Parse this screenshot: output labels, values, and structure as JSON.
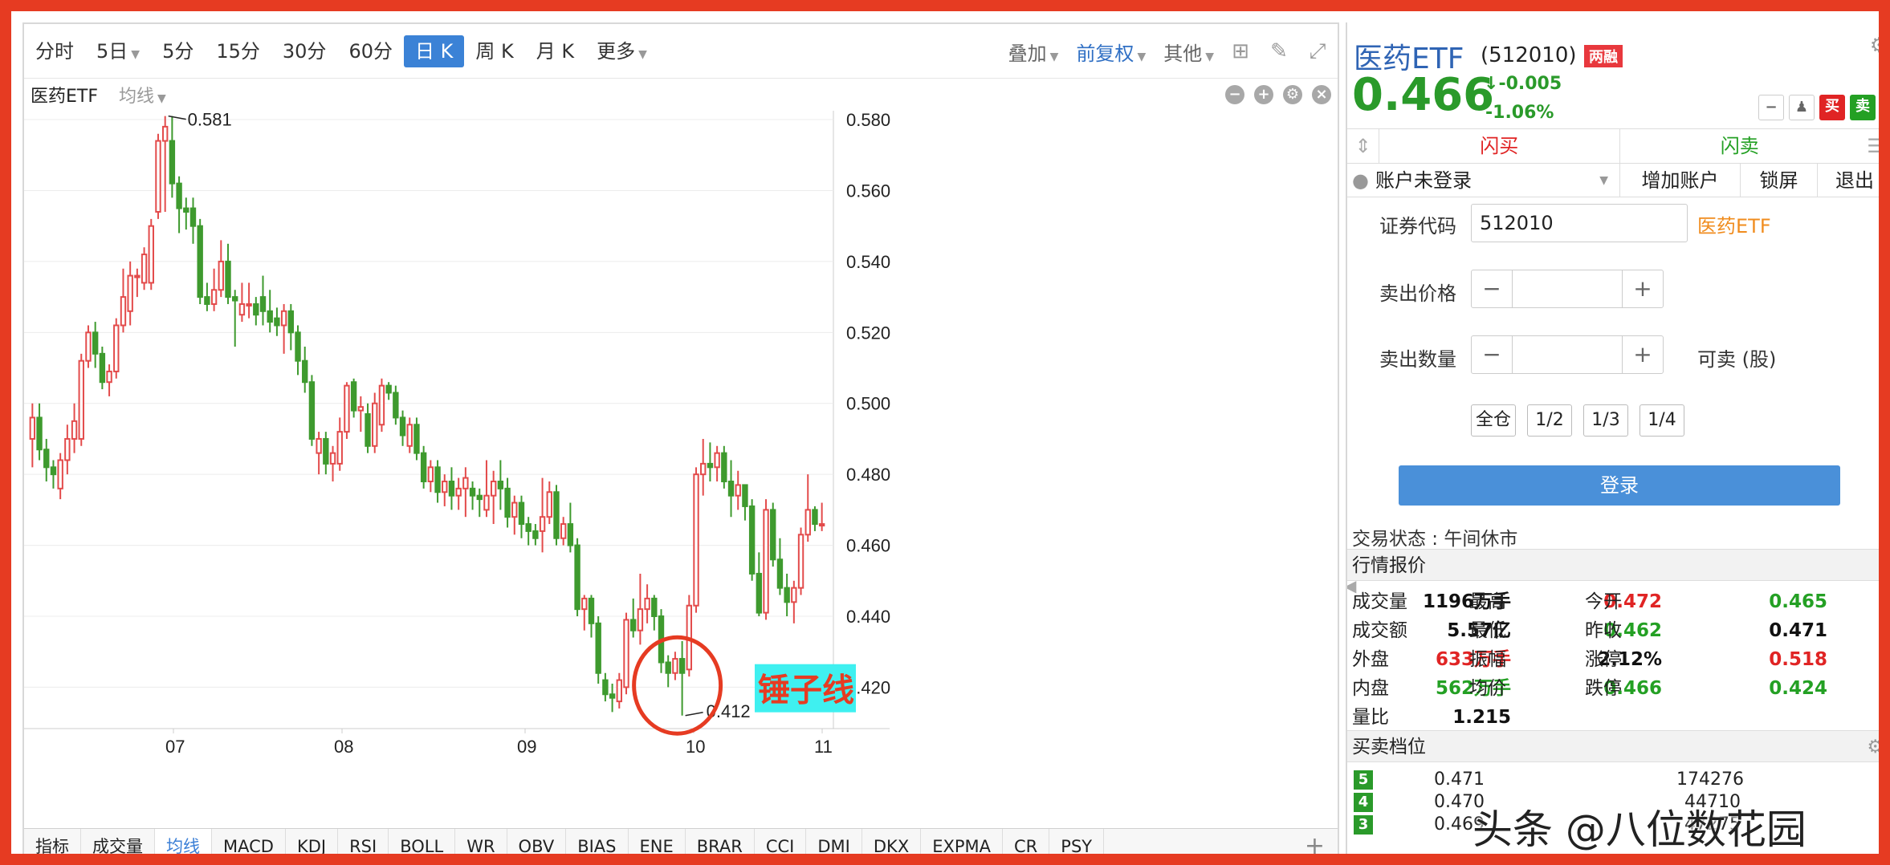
{
  "toolbar": {
    "periods": [
      "分时",
      "5日",
      "5分",
      "15分",
      "30分",
      "60分",
      "日 K",
      "周 K",
      "月 K",
      "更多"
    ],
    "active_period": "日 K",
    "overlay": "叠加",
    "adjust": "前复权",
    "other": "其他"
  },
  "subbar": {
    "name": "医药ETF",
    "ma": "均线"
  },
  "chart_data": {
    "type": "candlestick",
    "y_ticks": [
      "0.580",
      "0.560",
      "0.540",
      "0.520",
      "0.500",
      "0.480",
      "0.460",
      "0.440",
      "0.420"
    ],
    "ylim": [
      0.4115,
      0.5825
    ],
    "x_ticks": [
      "07",
      "08",
      "09",
      "10",
      "11"
    ],
    "high_label": "0.581",
    "low_label": "0.412",
    "annotation": "锤子线",
    "up_color": "#e34b4b",
    "down_color": "#3e9a2e",
    "candles": [
      [
        0.49,
        0.496,
        0.482,
        0.5
      ],
      [
        0.496,
        0.487,
        0.484,
        0.5
      ],
      [
        0.487,
        0.482,
        0.478,
        0.49
      ],
      [
        0.482,
        0.48,
        0.476,
        0.484
      ],
      [
        0.476,
        0.484,
        0.473,
        0.486
      ],
      [
        0.484,
        0.49,
        0.48,
        0.494
      ],
      [
        0.49,
        0.495,
        0.486,
        0.5
      ],
      [
        0.49,
        0.512,
        0.488,
        0.514
      ],
      [
        0.512,
        0.52,
        0.51,
        0.522
      ],
      [
        0.52,
        0.514,
        0.51,
        0.523
      ],
      [
        0.514,
        0.506,
        0.504,
        0.516
      ],
      [
        0.506,
        0.509,
        0.502,
        0.511
      ],
      [
        0.509,
        0.522,
        0.507,
        0.524
      ],
      [
        0.522,
        0.53,
        0.52,
        0.538
      ],
      [
        0.526,
        0.536,
        0.522,
        0.54
      ],
      [
        0.536,
        0.536,
        0.53,
        0.538
      ],
      [
        0.534,
        0.542,
        0.532,
        0.544
      ],
      [
        0.534,
        0.55,
        0.532,
        0.552
      ],
      [
        0.554,
        0.574,
        0.552,
        0.576
      ],
      [
        0.574,
        0.578,
        0.554,
        0.581
      ],
      [
        0.574,
        0.562,
        0.558,
        0.581
      ],
      [
        0.562,
        0.555,
        0.548,
        0.564
      ],
      [
        0.555,
        0.554,
        0.549,
        0.558
      ],
      [
        0.555,
        0.55,
        0.545,
        0.558
      ],
      [
        0.55,
        0.53,
        0.528,
        0.552
      ],
      [
        0.53,
        0.528,
        0.526,
        0.534
      ],
      [
        0.528,
        0.532,
        0.526,
        0.538
      ],
      [
        0.532,
        0.54,
        0.53,
        0.546
      ],
      [
        0.54,
        0.53,
        0.528,
        0.545
      ],
      [
        0.53,
        0.529,
        0.516,
        0.532
      ],
      [
        0.525,
        0.528,
        0.523,
        0.534
      ],
      [
        0.528,
        0.528,
        0.524,
        0.534
      ],
      [
        0.528,
        0.525,
        0.522,
        0.53
      ],
      [
        0.53,
        0.526,
        0.522,
        0.536
      ],
      [
        0.526,
        0.523,
        0.52,
        0.532
      ],
      [
        0.524,
        0.522,
        0.519,
        0.527
      ],
      [
        0.522,
        0.526,
        0.514,
        0.528
      ],
      [
        0.526,
        0.52,
        0.515,
        0.528
      ],
      [
        0.52,
        0.512,
        0.508,
        0.522
      ],
      [
        0.512,
        0.506,
        0.503,
        0.516
      ],
      [
        0.506,
        0.49,
        0.488,
        0.508
      ],
      [
        0.486,
        0.49,
        0.48,
        0.492
      ],
      [
        0.49,
        0.483,
        0.48,
        0.492
      ],
      [
        0.483,
        0.486,
        0.478,
        0.488
      ],
      [
        0.483,
        0.492,
        0.481,
        0.496
      ],
      [
        0.492,
        0.505,
        0.49,
        0.506
      ],
      [
        0.506,
        0.498,
        0.496,
        0.507
      ],
      [
        0.498,
        0.499,
        0.492,
        0.502
      ],
      [
        0.497,
        0.488,
        0.486,
        0.5
      ],
      [
        0.488,
        0.5,
        0.486,
        0.503
      ],
      [
        0.494,
        0.505,
        0.492,
        0.507
      ],
      [
        0.505,
        0.503,
        0.501,
        0.506
      ],
      [
        0.503,
        0.496,
        0.494,
        0.505
      ],
      [
        0.496,
        0.491,
        0.488,
        0.498
      ],
      [
        0.488,
        0.494,
        0.486,
        0.496
      ],
      [
        0.494,
        0.486,
        0.484,
        0.496
      ],
      [
        0.486,
        0.478,
        0.476,
        0.488
      ],
      [
        0.478,
        0.482,
        0.475,
        0.484
      ],
      [
        0.482,
        0.475,
        0.472,
        0.484
      ],
      [
        0.475,
        0.478,
        0.471,
        0.48
      ],
      [
        0.478,
        0.474,
        0.47,
        0.482
      ],
      [
        0.474,
        0.476,
        0.47,
        0.479
      ],
      [
        0.476,
        0.479,
        0.468,
        0.482
      ],
      [
        0.476,
        0.474,
        0.47,
        0.478
      ],
      [
        0.474,
        0.473,
        0.468,
        0.476
      ],
      [
        0.47,
        0.474,
        0.468,
        0.484
      ],
      [
        0.474,
        0.478,
        0.466,
        0.481
      ],
      [
        0.478,
        0.476,
        0.47,
        0.484
      ],
      [
        0.476,
        0.468,
        0.465,
        0.479
      ],
      [
        0.468,
        0.472,
        0.463,
        0.474
      ],
      [
        0.472,
        0.466,
        0.462,
        0.474
      ],
      [
        0.466,
        0.464,
        0.46,
        0.468
      ],
      [
        0.464,
        0.462,
        0.46,
        0.466
      ],
      [
        0.464,
        0.468,
        0.458,
        0.479
      ],
      [
        0.468,
        0.475,
        0.466,
        0.478
      ],
      [
        0.475,
        0.462,
        0.46,
        0.477
      ],
      [
        0.462,
        0.466,
        0.46,
        0.468
      ],
      [
        0.466,
        0.46,
        0.458,
        0.472
      ],
      [
        0.46,
        0.442,
        0.44,
        0.462
      ],
      [
        0.442,
        0.445,
        0.436,
        0.446
      ],
      [
        0.445,
        0.438,
        0.434,
        0.446
      ],
      [
        0.438,
        0.424,
        0.421,
        0.44
      ],
      [
        0.422,
        0.418,
        0.416,
        0.424
      ],
      [
        0.418,
        0.417,
        0.413,
        0.421
      ],
      [
        0.416,
        0.422,
        0.414,
        0.424
      ],
      [
        0.42,
        0.439,
        0.418,
        0.441
      ],
      [
        0.439,
        0.436,
        0.434,
        0.445
      ],
      [
        0.436,
        0.442,
        0.432,
        0.452
      ],
      [
        0.442,
        0.445,
        0.438,
        0.449
      ],
      [
        0.445,
        0.44,
        0.436,
        0.446
      ],
      [
        0.44,
        0.427,
        0.424,
        0.442
      ],
      [
        0.427,
        0.424,
        0.42,
        0.429
      ],
      [
        0.424,
        0.428,
        0.422,
        0.43
      ],
      [
        0.428,
        0.424,
        0.412,
        0.433
      ],
      [
        0.425,
        0.443,
        0.423,
        0.446
      ],
      [
        0.443,
        0.48,
        0.441,
        0.482
      ],
      [
        0.48,
        0.483,
        0.474,
        0.49
      ],
      [
        0.483,
        0.482,
        0.478,
        0.489
      ],
      [
        0.482,
        0.486,
        0.478,
        0.488
      ],
      [
        0.486,
        0.478,
        0.476,
        0.488
      ],
      [
        0.478,
        0.474,
        0.468,
        0.484
      ],
      [
        0.474,
        0.477,
        0.47,
        0.481
      ],
      [
        0.477,
        0.471,
        0.467,
        0.474
      ],
      [
        0.471,
        0.452,
        0.45,
        0.473
      ],
      [
        0.452,
        0.441,
        0.44,
        0.458
      ],
      [
        0.441,
        0.47,
        0.439,
        0.473
      ],
      [
        0.47,
        0.456,
        0.454,
        0.472
      ],
      [
        0.456,
        0.448,
        0.446,
        0.462
      ],
      [
        0.448,
        0.444,
        0.44,
        0.452
      ],
      [
        0.444,
        0.448,
        0.438,
        0.45
      ],
      [
        0.448,
        0.463,
        0.446,
        0.465
      ],
      [
        0.463,
        0.47,
        0.461,
        0.48
      ],
      [
        0.47,
        0.466,
        0.464,
        0.471
      ],
      [
        0.466,
        0.466,
        0.464,
        0.472
      ]
    ]
  },
  "bottom_tabs": [
    "指标",
    "成交量",
    "均线",
    "MACD",
    "KDJ",
    "RSI",
    "BOLL",
    "WR",
    "OBV",
    "BIAS",
    "ENE",
    "BRAR",
    "CCI",
    "DMI",
    "DKX",
    "EXPMA",
    "CR",
    "PSY"
  ],
  "bottom_active": "均线",
  "quote": {
    "name": "医药ETF",
    "code": "(512010)",
    "badge": "两融",
    "price": "0.466",
    "change": "-0.005",
    "change_pct": "-1.06%",
    "btn_buy": "买",
    "btn_sell": "卖"
  },
  "trade": {
    "flash_buy": "闪买",
    "flash_sell": "闪卖",
    "account": "账户未登录",
    "add_account": "增加账户",
    "lock": "锁屏",
    "logout": "退出",
    "code_label": "证券代码",
    "code_value": "512010",
    "code_name": "医药ETF",
    "price_label": "卖出价格",
    "qty_label": "卖出数量",
    "sellable": "可卖 (股)",
    "q_all": "全仓",
    "q_half": "1/2",
    "q_third": "1/3",
    "q_quarter": "1/4",
    "login": "登录"
  },
  "status": "交易状态 : 午间休市",
  "market": {
    "title": "行情报价",
    "rows": [
      {
        "l1": "成交量",
        "v1": "1196万手",
        "l2": "最高",
        "v2": "0.472",
        "l3": "今开",
        "v3": "0.465"
      },
      {
        "l1": "成交额",
        "v1": "5.57亿",
        "l2": "最低",
        "v2": "0.462",
        "l3": "昨收",
        "v3": "0.471"
      },
      {
        "l1": "外盘",
        "v1": "633万手",
        "l2": "振幅",
        "v2": "2.12%",
        "l3": "涨停",
        "v3": "0.518"
      },
      {
        "l1": "内盘",
        "v1": "562万手",
        "l2": "均价",
        "v2": "0.466",
        "l3": "跌停",
        "v3": "0.424"
      },
      {
        "l1": "量比",
        "v1": "1.215",
        "l2": "",
        "v2": "",
        "l3": "",
        "v3": ""
      }
    ]
  },
  "orderbook": {
    "title": "买卖档位",
    "rows": [
      {
        "level": "5",
        "price": "0.471",
        "vol": "174276"
      },
      {
        "level": "4",
        "price": "0.470",
        "vol": "44710"
      },
      {
        "level": "3",
        "price": "0.469",
        "vol": "47275"
      }
    ]
  },
  "watermark": "头条 @八位数花园"
}
